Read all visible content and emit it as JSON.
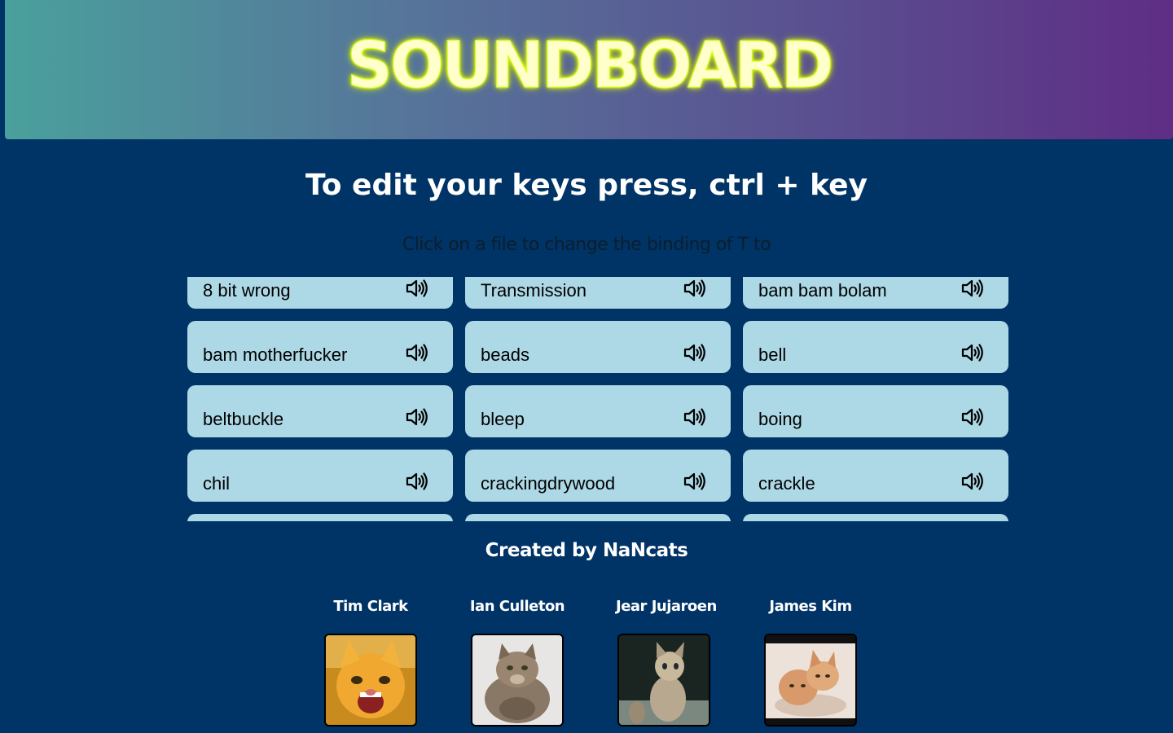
{
  "header": {
    "title": "SOUNDBOARD"
  },
  "instructions": {
    "heading": "To edit your keys press, ctrl + key",
    "hint": "Click on a file to change the binding of T to"
  },
  "sounds": [
    {
      "label": "8 bit wrong",
      "icon": "speaker-icon"
    },
    {
      "label": "Transmission",
      "icon": "speaker-icon"
    },
    {
      "label": "bam bam bolam",
      "icon": "speaker-icon"
    },
    {
      "label": "bam motherfucker",
      "icon": "speaker-icon"
    },
    {
      "label": "beads",
      "icon": "speaker-icon"
    },
    {
      "label": "bell",
      "icon": "speaker-icon"
    },
    {
      "label": "beltbuckle",
      "icon": "speaker-icon"
    },
    {
      "label": "bleep",
      "icon": "speaker-icon"
    },
    {
      "label": "boing",
      "icon": "speaker-icon"
    },
    {
      "label": "chil",
      "icon": "speaker-icon"
    },
    {
      "label": "crackingdrywood",
      "icon": "speaker-icon"
    },
    {
      "label": "crackle",
      "icon": "speaker-icon"
    },
    {
      "label": "",
      "icon": "speaker-icon"
    },
    {
      "label": "",
      "icon": "speaker-icon"
    },
    {
      "label": "",
      "icon": "speaker-icon"
    }
  ],
  "footer": {
    "credits": "Created by NaNcats",
    "team": [
      {
        "name": "Tim Clark",
        "avatar": "orange-kitten-photo"
      },
      {
        "name": "Ian Culleton",
        "avatar": "fluffy-cat-photo"
      },
      {
        "name": "Jear Jujaroen",
        "avatar": "tabby-kitten-photo"
      },
      {
        "name": "James Kim",
        "avatar": "two-kittens-photo"
      }
    ]
  },
  "colors": {
    "background": "#003366",
    "tile": "#add8e6",
    "title_glow": "#d9ff1a"
  }
}
